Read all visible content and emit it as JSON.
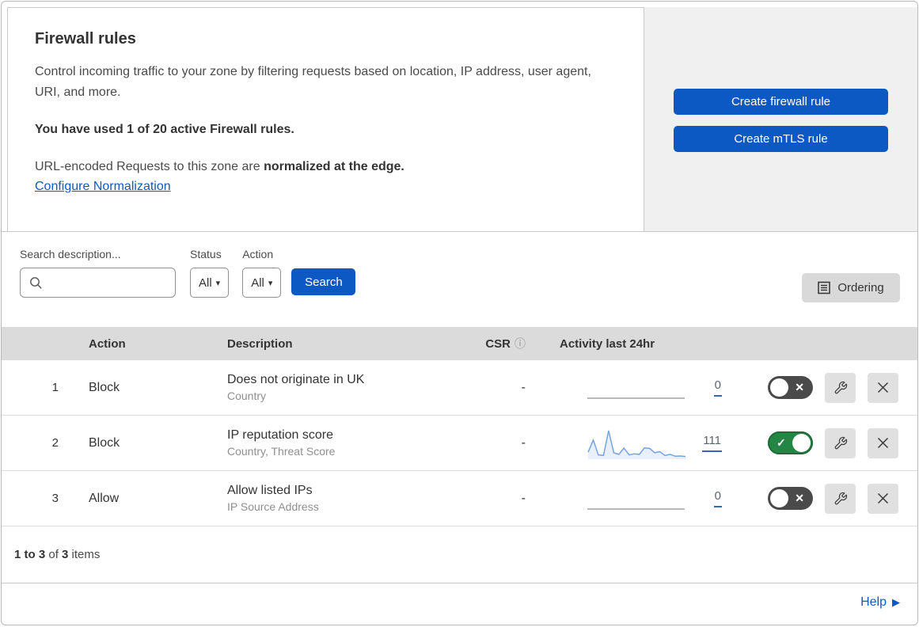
{
  "header": {
    "title": "Firewall rules",
    "description": "Control incoming traffic to your zone by filtering requests based on location, IP address, user agent, URI, and more.",
    "usage": "You have used 1 of 20 active Firewall rules.",
    "normalization_text": "URL-encoded Requests to this zone are ",
    "normalization_bold": "normalized at the edge.",
    "normalization_link": "Configure Normalization",
    "buttons": [
      {
        "label": "Create firewall rule"
      },
      {
        "label": "Create mTLS rule"
      }
    ]
  },
  "filters": {
    "search_label": "Search description...",
    "status_label": "Status",
    "status_value": "All",
    "action_label": "Action",
    "action_value": "All",
    "search_button": "Search",
    "ordering_button": "Ordering"
  },
  "table": {
    "columns": {
      "action": "Action",
      "description": "Description",
      "csr": "CSR",
      "activity": "Activity last 24hr"
    },
    "rows": [
      {
        "priority": "1",
        "action": "Block",
        "description": "Does not originate in UK",
        "criteria": "Country",
        "csr": "-",
        "activity_count": "0",
        "enabled": false,
        "sparkline": null
      },
      {
        "priority": "2",
        "action": "Block",
        "description": "IP reputation score",
        "criteria": "Country, Threat Score",
        "csr": "-",
        "activity_count": "111",
        "enabled": true,
        "sparkline": [
          20,
          65,
          10,
          8,
          100,
          18,
          12,
          35,
          10,
          14,
          12,
          36,
          34,
          18,
          22,
          8,
          12,
          5,
          6,
          4
        ]
      },
      {
        "priority": "3",
        "action": "Allow",
        "description": "Allow listed IPs",
        "criteria": "IP Source Address",
        "csr": "-",
        "activity_count": "0",
        "enabled": false,
        "sparkline": null
      }
    ]
  },
  "footer": {
    "range_bold": "1 to 3",
    "of_text": " of ",
    "total_bold": "3",
    "items_text": " items",
    "help": "Help"
  },
  "colors": {
    "primary_blue": "#0d59c3",
    "toggle_on_green": "#258545",
    "toggle_off_gray": "#4a4a4a",
    "sparkline_blue": "#74a3e0",
    "table_header_gray": "#dbdbdb",
    "side_panel_gray": "#f0f0f0"
  }
}
